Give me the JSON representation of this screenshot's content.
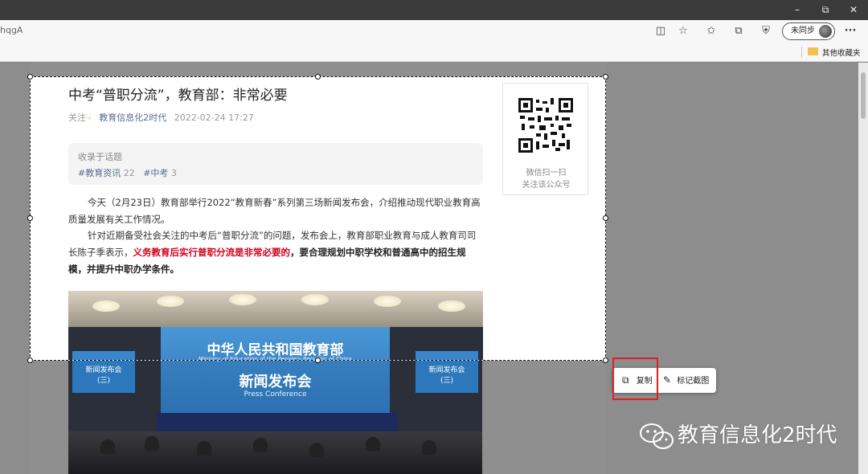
{
  "browser": {
    "address_fragment": "hqgA",
    "sync_label": "未同步",
    "more_label": "···",
    "window_controls": [
      "minimize-icon",
      "restore-icon",
      "close-icon"
    ],
    "toolbar_icons": [
      "immersive-reader-icon",
      "add-favorite-icon",
      "favorites-icon",
      "collections-icon",
      "browser-essentials-icon"
    ],
    "other_favorites": "其他收藏夹"
  },
  "article": {
    "title": "中考“普职分流”，教育部：非常必要",
    "follow_label": "关注",
    "account": "教育信息化2时代",
    "datetime": "2022-02-24 17:27",
    "topics": {
      "heading": "收录于话题",
      "tags": [
        {
          "name": "#教育资讯",
          "count": "22"
        },
        {
          "name": "#中考",
          "count": "3"
        }
      ]
    },
    "qr_caption_1": "微信扫一扫",
    "qr_caption_2": "关注该公众号",
    "para1": "今天（2月23日）教育部举行2022“教育新春”系列第三场新闻发布会，介绍推动现代职业教育高质量发展有关工作情况。",
    "para2_prefix": "针对近期备受社会关注的中考后“普职分流”的问题，发布会上，教育部职业教育与成人教育司司长陈子季表示，",
    "para2_red": "义务教育后实行普职分流是非常必要的",
    "para2_bold": "，要合理规划中职学校和普通高中的招生规模，并提升中职办学条件。",
    "photo": {
      "ministry_cn": "中华人民共和国教育部",
      "ministry_en": "Ministry of Education of the People's Republic of China",
      "press_cn": "新闻发布会",
      "press_en": "Press Conference",
      "side_left": "新闻发布会",
      "side_left_sub": "(三)",
      "side_right": "新闻发布会",
      "side_right_sub": "(三)"
    }
  },
  "context_menu": {
    "copy_label": "复制",
    "annotate_label": "标记截图"
  },
  "watermark": "教育信息化2时代",
  "colors": {
    "accent_link": "#576b95",
    "highlight_red": "#d0021b",
    "callout_red": "#e02020"
  }
}
